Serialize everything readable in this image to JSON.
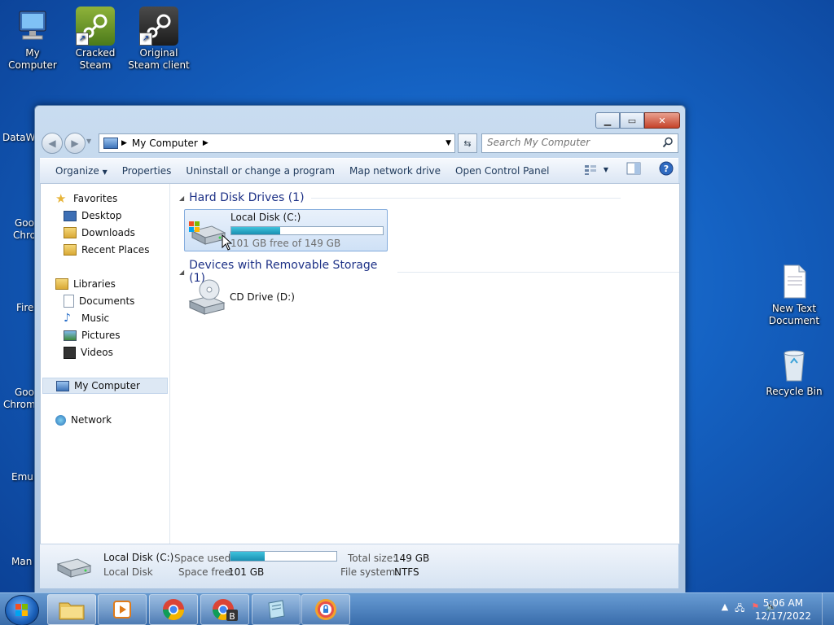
{
  "desktop": {
    "icons": [
      {
        "label": "My Computer"
      },
      {
        "label": "Cracked Steam"
      },
      {
        "label": "Original Steam client"
      },
      {
        "label": "New Text Document"
      },
      {
        "label": "Recycle Bin"
      }
    ],
    "partial_labels": [
      "DataWa",
      "Goo",
      "Chro",
      "Fire",
      "Goo",
      "Chrom",
      "Emul",
      "Man"
    ]
  },
  "window": {
    "address": {
      "path_root": "My Computer"
    },
    "search": {
      "placeholder": "Search My Computer"
    },
    "toolbar": {
      "organize": "Organize",
      "properties": "Properties",
      "uninstall": "Uninstall or change a program",
      "map_drive": "Map network drive",
      "control_panel": "Open Control Panel"
    },
    "nav": {
      "favorites": "Favorites",
      "desktop": "Desktop",
      "downloads": "Downloads",
      "recent": "Recent Places",
      "libraries": "Libraries",
      "documents": "Documents",
      "music": "Music",
      "pictures": "Pictures",
      "videos": "Videos",
      "computer": "My Computer",
      "network": "Network"
    },
    "groups": {
      "hdd": "Hard Disk Drives (1)",
      "removable": "Devices with Removable Storage (1)"
    },
    "drives": {
      "c_name": "Local Disk (C:)",
      "c_free": "101 GB free of 149 GB",
      "c_used_fraction": 0.32,
      "d_name": "CD Drive (D:)"
    },
    "details": {
      "name": "Local Disk (C:)",
      "type": "Local Disk",
      "space_used_label": "Space used:",
      "space_free_label": "Space free:",
      "space_free": "101 GB",
      "total_label": "Total size:",
      "total": "149 GB",
      "fs_label": "File system:",
      "fs": "NTFS"
    }
  },
  "taskbar": {
    "time": "5:06 AM",
    "date": "12/17/2022"
  }
}
